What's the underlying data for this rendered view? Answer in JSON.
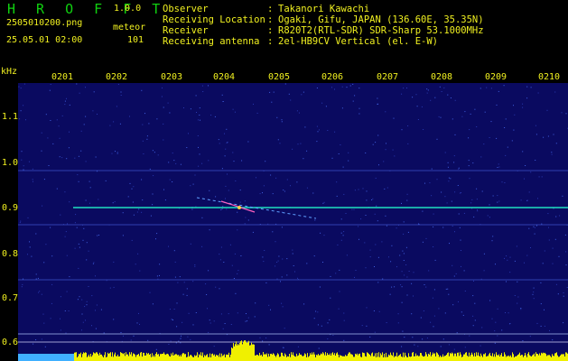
{
  "app": {
    "name": "H R O F F T",
    "version": "1.0.0"
  },
  "file": {
    "name": "2505010200.png",
    "datetime": "25.05.01 02:00"
  },
  "detection": {
    "label": "meteor",
    "count": "101"
  },
  "info": [
    {
      "key": "Observer",
      "value": "Takanori Kawachi"
    },
    {
      "key": "Receiving Location",
      "value": "Ogaki, Gifu, JAPAN (136.60E, 35.35N)"
    },
    {
      "key": "Receiver",
      "value": "R820T2(RTL-SDR) SDR-Sharp 53.1000MHz"
    },
    {
      "key": "Receiving antenna",
      "value": "2el-HB9CV Vertical (el. E-W)"
    }
  ],
  "axis": {
    "unit": "kHz",
    "x_ticks": [
      "0201",
      "0202",
      "0203",
      "0204",
      "0205",
      "0206",
      "0207",
      "0208",
      "0209",
      "0210"
    ],
    "y_ticks": [
      "1.1",
      "1.0",
      "0.9",
      "0.8",
      "0.7",
      "0.6"
    ]
  },
  "colors": {
    "background": "#0a0a60",
    "carrier": "#20e0c0",
    "text": "#f0f020",
    "title": "#10d010",
    "bars": "#f0f000",
    "baseline": "#40b0ff"
  }
}
